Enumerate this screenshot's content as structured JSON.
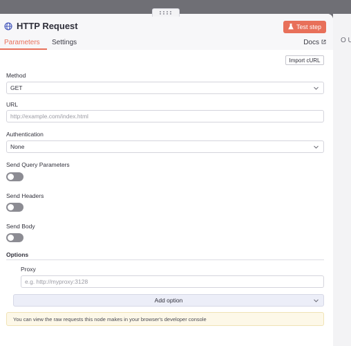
{
  "node": {
    "title": "HTTP Request",
    "test_button": "Test step"
  },
  "tabs": {
    "parameters": "Parameters",
    "settings": "Settings",
    "docs": "Docs"
  },
  "import_curl": "Import cURL",
  "method": {
    "label": "Method",
    "value": "GET"
  },
  "url": {
    "label": "URL",
    "placeholder": "http://example.com/index.html"
  },
  "authentication": {
    "label": "Authentication",
    "value": "None"
  },
  "send_query": {
    "label": "Send Query Parameters",
    "enabled": false
  },
  "send_headers": {
    "label": "Send Headers",
    "enabled": false
  },
  "send_body": {
    "label": "Send Body",
    "enabled": false
  },
  "options": {
    "title": "Options",
    "proxy_label": "Proxy",
    "proxy_placeholder": "e.g. http://myproxy:3128",
    "add_option": "Add option"
  },
  "notice": "You can view the raw requests this node makes in your browser's developer console",
  "right_panel": {
    "label": "O U"
  },
  "colors": {
    "accent": "#e8705a",
    "toggle_off": "#8c8c93"
  }
}
